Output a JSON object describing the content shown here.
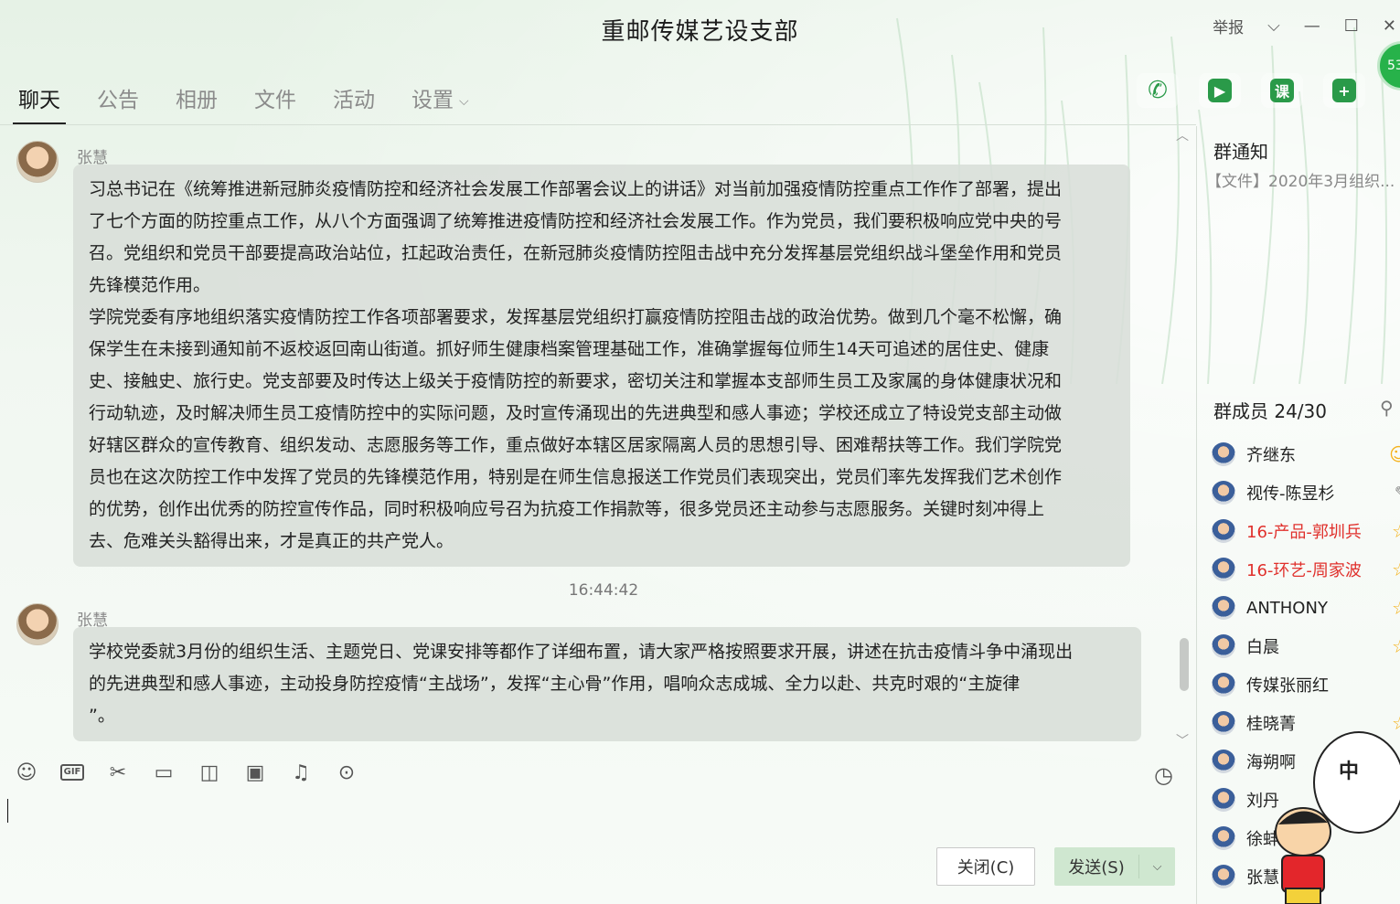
{
  "window": {
    "title": "重邮传媒艺设支部",
    "report_label": "举报",
    "minimize": "—",
    "maximize": "☐",
    "close": "✕"
  },
  "tabs": [
    {
      "label": "聊天",
      "active": true
    },
    {
      "label": "公告",
      "active": false
    },
    {
      "label": "相册",
      "active": false
    },
    {
      "label": "文件",
      "active": false
    },
    {
      "label": "活动",
      "active": false
    },
    {
      "label": "设置",
      "active": false
    }
  ],
  "actions": {
    "icons": [
      "phone-icon",
      "video-icon",
      "lesson-icon",
      "add-app-icon"
    ],
    "lesson_label": "课",
    "badge": "53"
  },
  "messages": [
    {
      "sender": "张慧",
      "text": "习总书记在《统筹推进新冠肺炎疫情防控和经济社会发展工作部署会议上的讲话》对当前加强疫情防控重点工作作了部署，提出\n了七个方面的防控重点工作，从八个方面强调了统筹推进疫情防控和经济社会发展工作。作为党员，我们要积极响应党中央的号\n召。党组织和党员干部要提高政治站位，扛起政治责任，在新冠肺炎疫情防控阻击战中充分发挥基层党组织战斗堡垒作用和党员\n先锋模范作用。\n学院党委有序地组织落实疫情防控工作各项部署要求，发挥基层党组织打赢疫情防控阻击战的政治优势。做到几个毫不松懈，确\n保学生在未接到通知前不返校返回南山街道。抓好师生健康档案管理基础工作，准确掌握每位师生14天可追述的居住史、健康\n史、接触史、旅行史。党支部要及时传达上级关于疫情防控的新要求，密切关注和掌握本支部师生员工及家属的身体健康状况和\n行动轨迹，及时解决师生员工疫情防控中的实际问题，及时宣传涌现出的先进典型和感人事迹；学校还成立了特设党支部主动做\n好辖区群众的宣传教育、组织发动、志愿服务等工作，重点做好本辖区居家隔离人员的思想引导、困难帮扶等工作。我们学院党\n员也在这次防控工作中发挥了党员的先锋模范作用，特别是在师生信息报送工作党员们表现突出，党员们率先发挥我们艺术创作\n的优势，创作出优秀的防控宣传作品，同时积极响应号召为抗疫工作捐款等，很多党员还主动参与志愿服务。关键时刻冲得上\n去、危难关头豁得出来，才是真正的共产党人。"
    },
    {
      "timestamp": "16:44:42",
      "sender": "张慧",
      "text": "学校党委就3月份的组织生活、主题党日、党课安排等都作了详细布置，请大家严格按照要求开展，讲述在抗击疫情斗争中涌现出\n的先进典型和感人事迹，主动投身防控疫情“主战场”，发挥“主心骨”作用，唱响众志成城、全力以赴、共克时艰的“主旋律\n”。"
    }
  ],
  "toolbar": {
    "icons": [
      "emoji-icon",
      "gif-icon",
      "screenshot-scissors-icon",
      "folder-icon",
      "sticker-icon",
      "image-icon",
      "bell-icon",
      "more-icon"
    ],
    "gif_label": "GIF",
    "history_icon": "clock-icon"
  },
  "input": {
    "value": ""
  },
  "buttons": {
    "close": "关闭(C)",
    "send": "发送(S)"
  },
  "notice": {
    "heading": "群通知",
    "text": "【文件】2020年3月组织..."
  },
  "members": {
    "heading": "群成员 24/30",
    "list": [
      {
        "name": "齐继东",
        "red": false,
        "mark": "owner-icon"
      },
      {
        "name": "视传-陈昱杉",
        "red": false,
        "mark": "edit-icon"
      },
      {
        "name": "16-产品-郭圳兵",
        "red": true,
        "mark": "star-icon"
      },
      {
        "name": "16-环艺-周家波",
        "red": true,
        "mark": "star-icon"
      },
      {
        "name": "ANTHONY",
        "red": false,
        "mark": "star-icon"
      },
      {
        "name": "白晨",
        "red": false,
        "mark": "star-icon"
      },
      {
        "name": "传媒张丽红",
        "red": false,
        "mark": ""
      },
      {
        "name": "桂晓菁",
        "red": false,
        "mark": "star-icon"
      },
      {
        "name": "海朔啊",
        "red": false,
        "mark": ""
      },
      {
        "name": "刘丹",
        "red": false,
        "mark": ""
      },
      {
        "name": "徐蚌",
        "red": false,
        "mark": ""
      },
      {
        "name": "张慧",
        "red": false,
        "mark": ""
      }
    ]
  },
  "sticker": {
    "text": "中"
  }
}
